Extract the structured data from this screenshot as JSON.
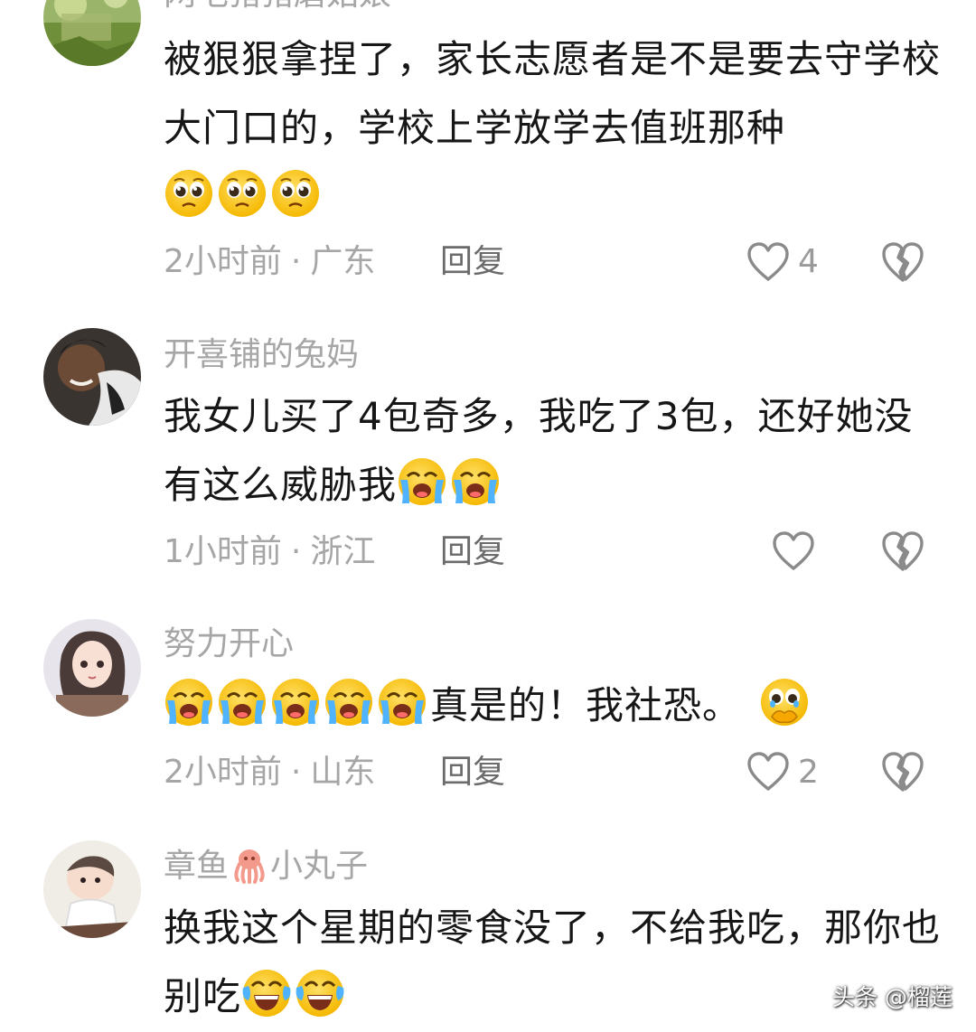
{
  "comments": [
    {
      "username": "网毛猪猪磨姑娘",
      "text": "被狠狠拿捏了，家长志愿者是不是要去守学校大门口的，学校上学放学去值班那种",
      "emoji": "pleading-face-emoji ×3",
      "time": "2小时前",
      "location": "广东",
      "reply_label": "回复",
      "likes": "4"
    },
    {
      "username": "开喜铺的兔妈",
      "text": "我女儿买了4包奇多，我吃了3包，还好她没有这么威胁我",
      "emoji": "crying-face-emoji ×2",
      "time": "1小时前",
      "location": "浙江",
      "reply_label": "回复",
      "likes": ""
    },
    {
      "username": "努力开心",
      "text_after": "真是的！我社恐。",
      "emoji": "crying-face-emoji ×5, holding-back-tears-emoji",
      "time": "2小时前",
      "location": "山东",
      "reply_label": "回复",
      "likes": "2"
    },
    {
      "username_pre": "章鱼",
      "username_icon": "octopus-emoji",
      "username_post": "小丸子",
      "text": "换我这个星期的零食没了，不给我吃，那你也别吃",
      "emoji": "crying-laughing-emoji ×2"
    }
  ],
  "watermark": "头条 @榴莲",
  "colors": {
    "text": "#161616",
    "meta": "#a6a6a6",
    "icon": "#8a8a8a"
  }
}
